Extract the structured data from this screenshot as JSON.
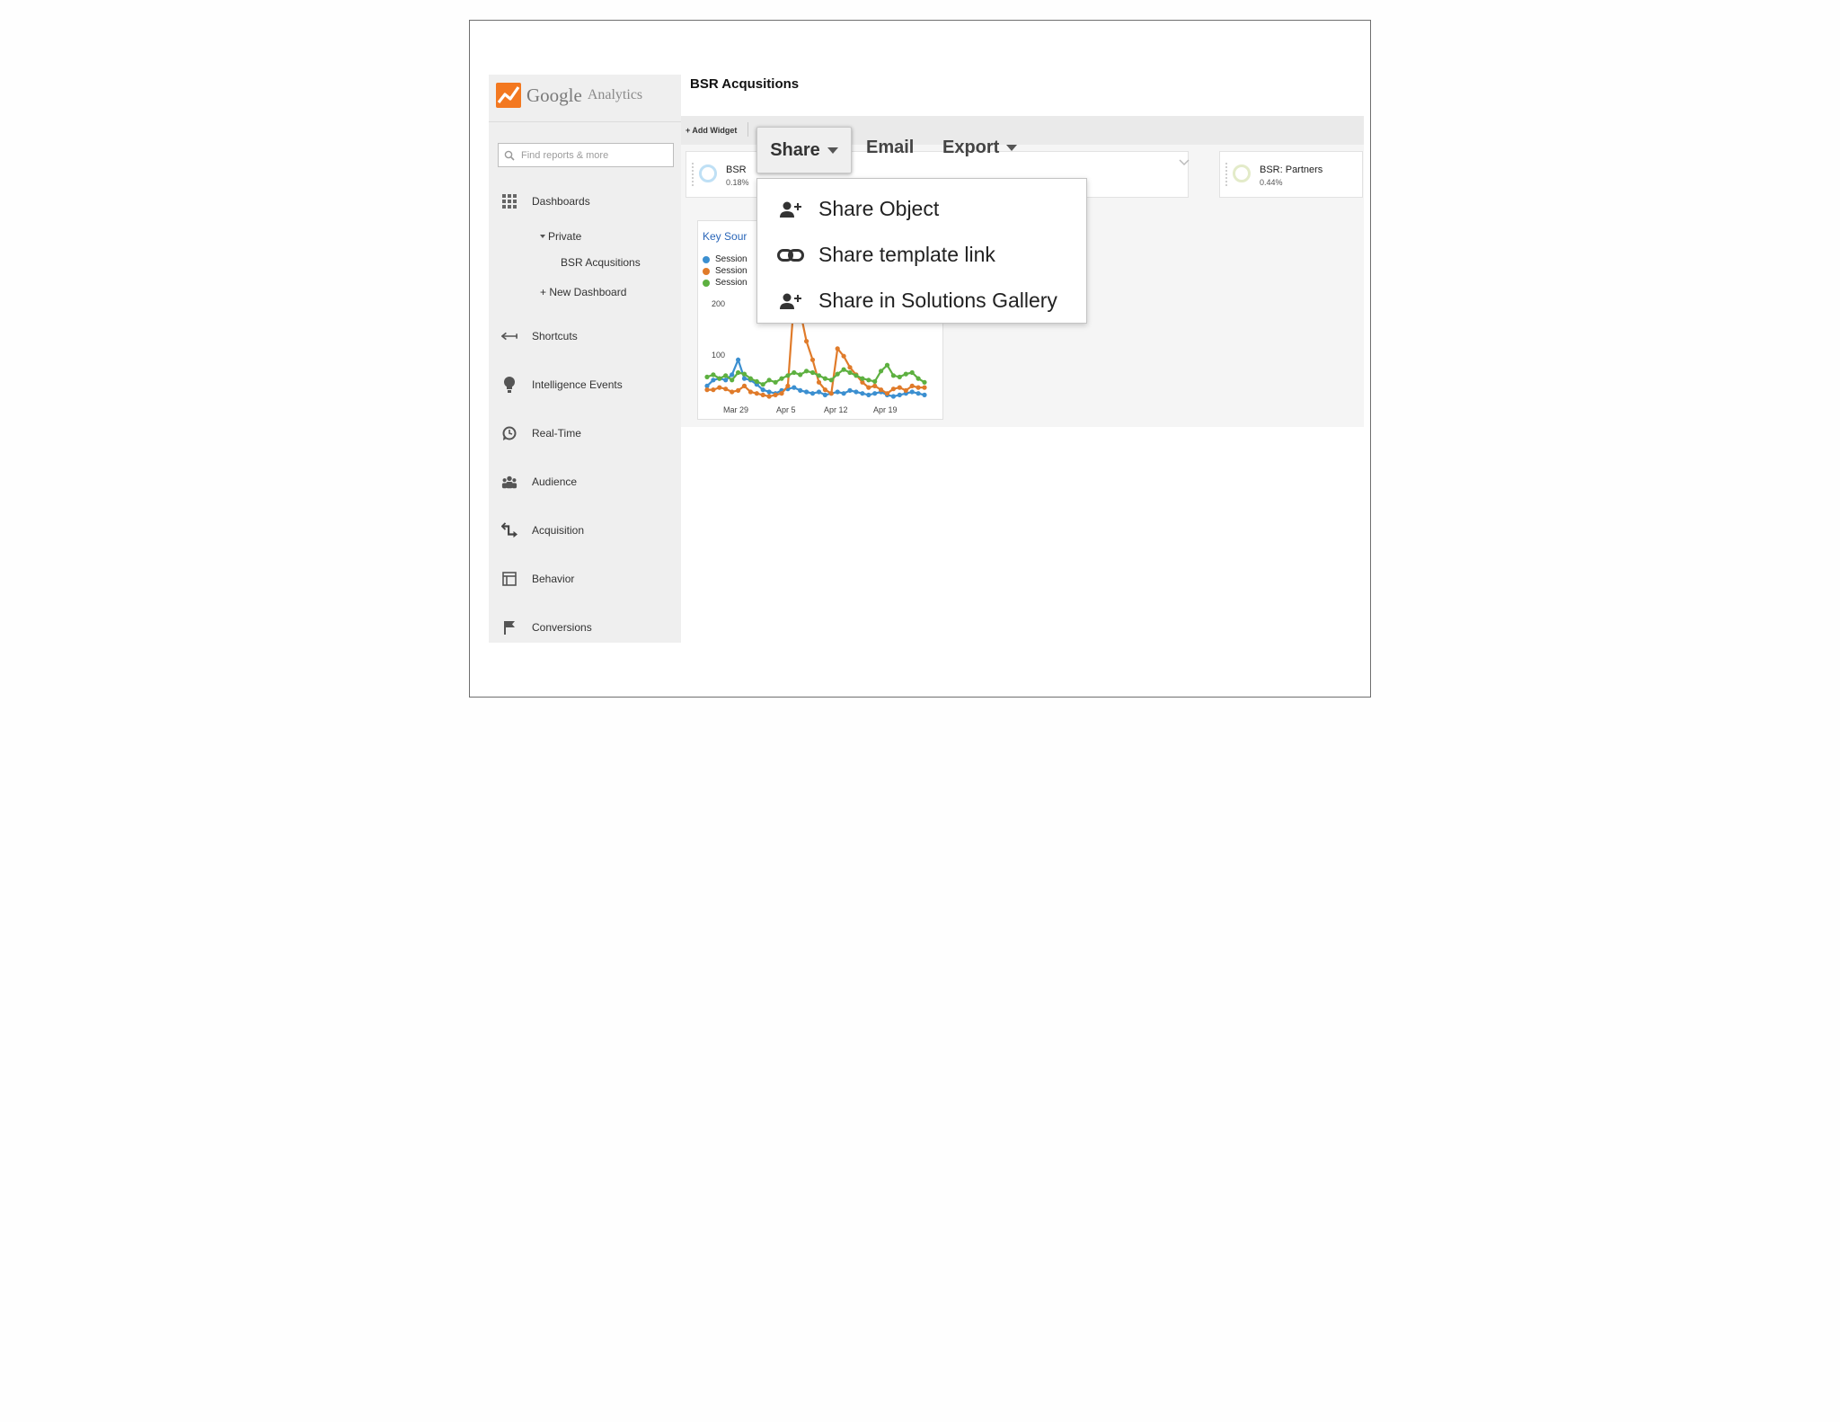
{
  "app": {
    "brand": "Google",
    "product": "Analytics"
  },
  "sidebar": {
    "search_placeholder": "Find reports & more",
    "dashboards": "Dashboards",
    "private": "Private",
    "bsr": "BSR Acqusitions",
    "new_dashboard": "+ New Dashboard",
    "items": [
      {
        "label": "Shortcuts",
        "icon": "shortcuts-icon"
      },
      {
        "label": "Intelligence Events",
        "icon": "lightbulb-icon"
      },
      {
        "label": "Real-Time",
        "icon": "clock-icon"
      },
      {
        "label": "Audience",
        "icon": "people-icon"
      },
      {
        "label": "Acquisition",
        "icon": "acquisition-arrows-icon"
      },
      {
        "label": "Behavior",
        "icon": "layout-icon"
      },
      {
        "label": "Conversions",
        "icon": "flag-icon"
      }
    ]
  },
  "page": {
    "title": "BSR Acqusitions"
  },
  "toolbar": {
    "add_widget": "+ Add Widget",
    "share": "Share",
    "email": "Email",
    "export": "Export"
  },
  "share_menu": [
    {
      "label": "Share Object",
      "icon": "add-person-icon"
    },
    {
      "label": "Share template link",
      "icon": "link-icon"
    },
    {
      "label": "Share in Solutions Gallery",
      "icon": "add-person-icon"
    }
  ],
  "cards": {
    "first": {
      "name": "BSR",
      "value": "0.18%"
    },
    "partners": {
      "name": "BSR: Partners",
      "value": "0.44%"
    }
  },
  "widget": {
    "title": "Key Sour",
    "legend": [
      "Session",
      "Session",
      "Session"
    ]
  },
  "colors": {
    "blue": "#3b8fd0",
    "orange": "#e07b2a",
    "green": "#5db040",
    "ga_orange": "#f37820"
  },
  "chart_data": {
    "type": "line",
    "x_ticks": [
      "Mar 29",
      "Apr 5",
      "Apr 12",
      "Apr 19"
    ],
    "y_ticks": [
      "100",
      "200"
    ],
    "ylim": [
      0,
      200
    ],
    "series": [
      {
        "color": "#3b8fd0",
        "values": [
          20,
          28,
          30,
          28,
          35,
          55,
          30,
          28,
          22,
          15,
          12,
          10,
          14,
          16,
          18,
          14,
          12,
          10,
          12,
          8,
          10,
          12,
          10,
          14,
          12,
          10,
          8,
          10,
          12,
          8,
          6,
          8,
          10,
          12,
          10,
          8
        ]
      },
      {
        "color": "#e07b2a",
        "values": [
          15,
          15,
          18,
          16,
          12,
          14,
          20,
          12,
          10,
          8,
          6,
          8,
          10,
          20,
          135,
          120,
          80,
          55,
          25,
          15,
          10,
          70,
          60,
          45,
          35,
          25,
          18,
          20,
          15,
          10,
          16,
          18,
          14,
          20,
          18,
          18
        ]
      },
      {
        "color": "#5db040",
        "values": [
          32,
          35,
          30,
          34,
          28,
          38,
          36,
          30,
          26,
          22,
          28,
          25,
          30,
          34,
          38,
          35,
          40,
          38,
          34,
          30,
          28,
          36,
          42,
          38,
          34,
          30,
          28,
          26,
          40,
          48,
          34,
          32,
          36,
          38,
          30,
          25
        ]
      }
    ]
  }
}
